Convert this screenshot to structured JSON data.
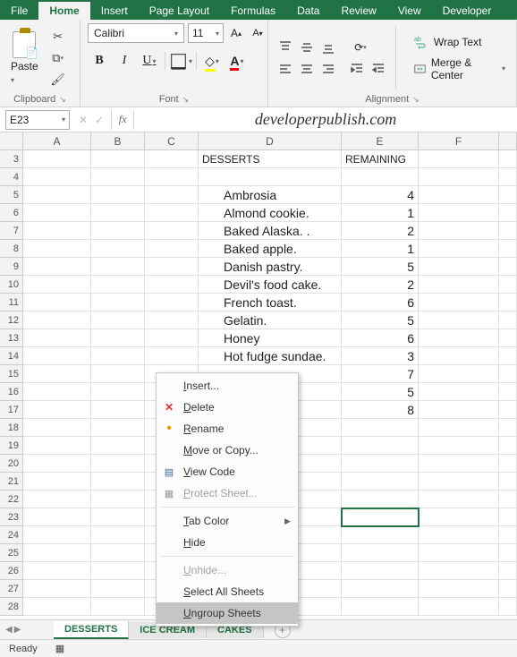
{
  "tabs": [
    "File",
    "Home",
    "Insert",
    "Page Layout",
    "Formulas",
    "Data",
    "Review",
    "View",
    "Developer"
  ],
  "active_tab": "Home",
  "ribbon": {
    "clipboard": {
      "paste": "Paste",
      "label": "Clipboard"
    },
    "font": {
      "name": "Calibri",
      "size": "11",
      "label": "Font"
    },
    "alignment": {
      "wrap": "Wrap Text",
      "merge": "Merge & Center",
      "label": "Alignment"
    }
  },
  "namebox": "E23",
  "watermark": "developerpublish.com",
  "columns": [
    "A",
    "B",
    "C",
    "D",
    "E",
    "F"
  ],
  "row_start": 3,
  "row_end": 28,
  "headers": {
    "d": "DESSERTS",
    "e": "REMAINING"
  },
  "data_rows": [
    {
      "d": "Ambrosia",
      "e": "4"
    },
    {
      "d": "Almond cookie.",
      "e": "1"
    },
    {
      "d": "Baked Alaska. .",
      "e": "2"
    },
    {
      "d": "Baked apple.",
      "e": "1"
    },
    {
      "d": "Danish pastry.",
      "e": "5"
    },
    {
      "d": "Devil's food cake.",
      "e": "2"
    },
    {
      "d": "French toast.",
      "e": "6"
    },
    {
      "d": "Gelatin.",
      "e": "5"
    },
    {
      "d": "Honey",
      "e": "6"
    },
    {
      "d": "Hot fudge sundae.",
      "e": "3"
    },
    {
      "d": "",
      "e": "7"
    },
    {
      "d": "",
      "e": "5"
    },
    {
      "d": "",
      "e": "8"
    }
  ],
  "selected_cell": "E23",
  "sheets": [
    "DESSERTS",
    "ICE CREAM",
    "CAKES"
  ],
  "active_sheet": "DESSERTS",
  "context_menu": {
    "items": [
      {
        "label": "Insert...",
        "key": "I",
        "icon": ""
      },
      {
        "label": "Delete",
        "key": "D",
        "icon": "del"
      },
      {
        "label": "Rename",
        "key": "R",
        "icon": "dot"
      },
      {
        "label": "Move or Copy...",
        "key": "M",
        "icon": ""
      },
      {
        "label": "View Code",
        "key": "V",
        "icon": "code"
      },
      {
        "label": "Protect Sheet...",
        "key": "P",
        "icon": "grid",
        "disabled": true
      },
      {
        "label": "Tab Color",
        "key": "T",
        "submenu": true
      },
      {
        "label": "Hide",
        "key": "H"
      },
      {
        "label": "Unhide...",
        "key": "U",
        "disabled": true
      },
      {
        "label": "Select All Sheets",
        "key": "S"
      },
      {
        "label": "Ungroup Sheets",
        "key": "U",
        "hover": true
      }
    ]
  },
  "status": {
    "mode": "Ready"
  }
}
